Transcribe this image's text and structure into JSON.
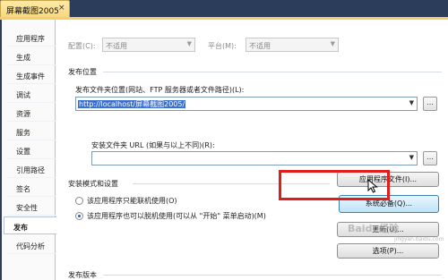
{
  "tab": {
    "title": "屏幕截图2005",
    "close": "×"
  },
  "sidebar": {
    "items": [
      {
        "label": "应用程序"
      },
      {
        "label": "生成"
      },
      {
        "label": "生成事件"
      },
      {
        "label": "调试"
      },
      {
        "label": "资源"
      },
      {
        "label": "服务"
      },
      {
        "label": "设置"
      },
      {
        "label": "引用路径"
      },
      {
        "label": "签名"
      },
      {
        "label": "安全性"
      },
      {
        "label": "发布"
      },
      {
        "label": "代码分析"
      }
    ],
    "active_index": 10
  },
  "config": {
    "config_label": "配置(C):",
    "config_value": "不适用",
    "platform_label": "平台(M):",
    "platform_value": "不适用"
  },
  "publish_location": {
    "section_title": "发布位置",
    "folder_label": "发布文件夹位置(网站、FTP 服务器或者文件路径)(L):",
    "folder_value": "http://localhost/屏幕截图2005/",
    "install_url_label": "安装文件夹 URL (如果与以上不同)(R):",
    "install_url_value": "",
    "browse_label": "..."
  },
  "install_mode": {
    "section_title": "安装模式和设置",
    "online_only_label": "该应用程序只能联机使用(O)",
    "offline_label": "该应用程序也可以脱机使用(可以从 \"开始\" 菜单启动)(M)",
    "selected": "offline"
  },
  "buttons": {
    "app_files": "应用程序文件(I)...",
    "prerequisites": "系统必备(Q)...",
    "updates": "更新(U)...",
    "options": "选项(P)..."
  },
  "publish_version": {
    "section_title": "发布版本"
  },
  "watermark": {
    "text": "Baidu经验",
    "sub": "jingyan.baidu.com"
  }
}
